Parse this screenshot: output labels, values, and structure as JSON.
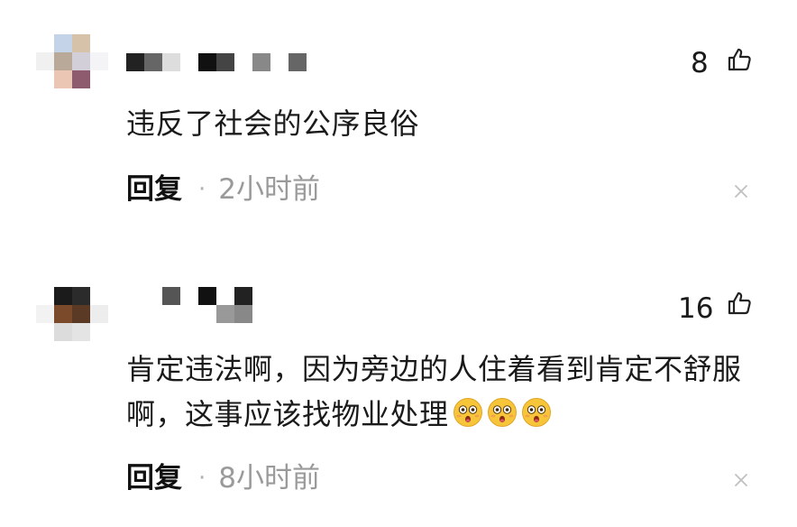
{
  "colors": {
    "text": "#1a1a1a",
    "muted": "#9a9a9a",
    "dot": "#b0b0b0",
    "close": "#c0c0c0"
  },
  "comments": [
    {
      "like_count": "8",
      "text": "违反了社会的公序良俗",
      "reply_label": "回复",
      "separator": "·",
      "time": "2小时前"
    },
    {
      "like_count": "16",
      "text": "肯定违法啊，因为旁边的人住着看到肯定不舒服啊，这事应该找物业处理",
      "emoji": [
        "flushed-face-icon",
        "flushed-face-icon",
        "flushed-face-icon"
      ],
      "reply_label": "回复",
      "separator": "·",
      "time": "8小时前"
    }
  ]
}
